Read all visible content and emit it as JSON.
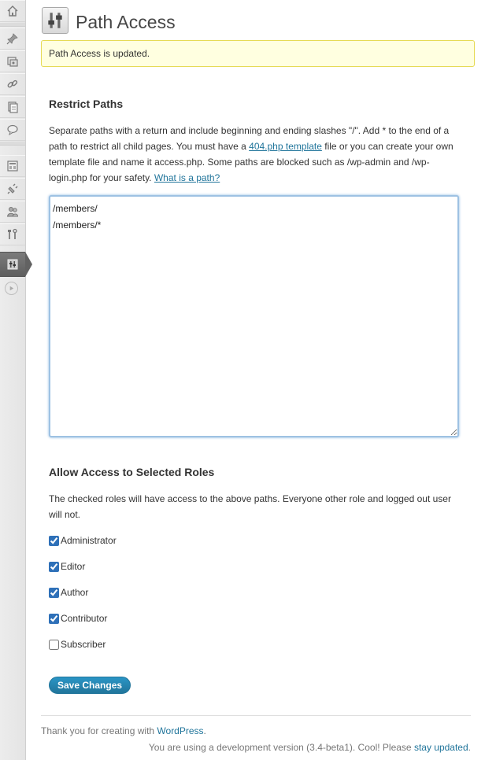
{
  "sidebar": {
    "items": [
      {
        "icon": "home-icon"
      },
      {
        "icon": "pin-icon"
      },
      {
        "icon": "media-icon"
      },
      {
        "icon": "link-icon"
      },
      {
        "icon": "pages-icon"
      },
      {
        "icon": "comments-icon"
      },
      {
        "icon": "appearance-icon"
      },
      {
        "icon": "plugins-icon"
      },
      {
        "icon": "users-icon"
      },
      {
        "icon": "tools-icon"
      },
      {
        "icon": "settings-icon",
        "current": true
      }
    ],
    "collapse_icon": "collapse-arrow-icon"
  },
  "header": {
    "title": "Path Access",
    "icon": "settings-sliders-icon"
  },
  "notice": {
    "message": "Path Access is updated."
  },
  "restrict": {
    "heading": "Restrict Paths",
    "desc_part1": "Separate paths with a return and include beginning and ending slashes \"/\". Add * to the end of a path to restrict all child pages. You must have a ",
    "desc_link1": "404.php template",
    "desc_part2": " file or you can create your own template file and name it access.php. Some paths are blocked such as /wp-admin and /wp-login.php for your safety. ",
    "desc_link2": "What is a path?",
    "textarea_value": "/members/\n/members/*"
  },
  "roles": {
    "heading": "Allow Access to Selected Roles",
    "description": "The checked roles will have access to the above paths. Everyone other role and logged out user will not.",
    "items": [
      {
        "label": "Administrator",
        "checked": true
      },
      {
        "label": "Editor",
        "checked": true
      },
      {
        "label": "Author",
        "checked": true
      },
      {
        "label": "Contributor",
        "checked": true
      },
      {
        "label": "Subscriber",
        "checked": false
      }
    ]
  },
  "actions": {
    "save_label": "Save Changes"
  },
  "footer": {
    "thanks_prefix": "Thank you for creating with ",
    "wordpress_link": "WordPress",
    "thanks_suffix": ".",
    "version_text": "You are using a development version (3.4-beta1). Cool! Please ",
    "update_link": "stay updated",
    "version_suffix": "."
  },
  "colors": {
    "link": "#21759b",
    "notice_bg": "#ffffe0",
    "notice_border": "#e6db55",
    "button": "#21759b"
  }
}
